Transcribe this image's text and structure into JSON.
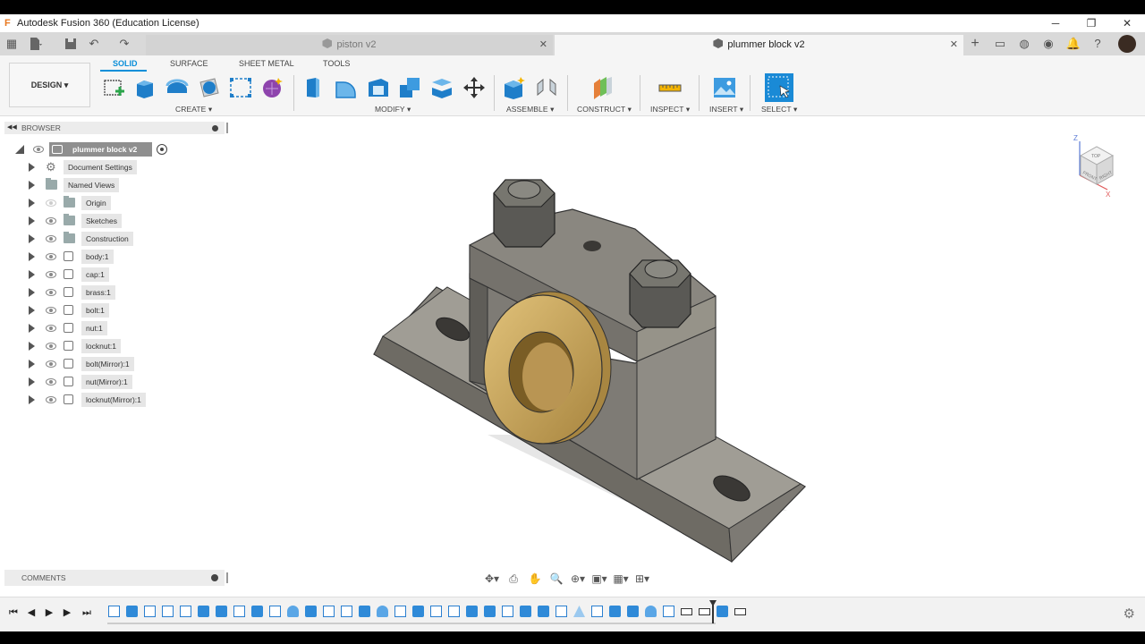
{
  "window": {
    "title": "Autodesk Fusion 360 (Education License)",
    "controls": [
      "─",
      "❐",
      "✕"
    ]
  },
  "tabs": [
    {
      "title": "piston v2",
      "active": false
    },
    {
      "title": "plummer block v2",
      "active": true
    }
  ],
  "toolbar": {
    "workspace": "DESIGN ▾",
    "workspace_tabs": [
      "SOLID",
      "SURFACE",
      "SHEET METAL",
      "TOOLS"
    ],
    "groups": {
      "create": "CREATE ▾",
      "modify": "MODIFY ▾",
      "assemble": "ASSEMBLE ▾",
      "construct": "CONSTRUCT ▾",
      "inspect": "INSPECT ▾",
      "insert": "INSERT ▾",
      "select": "SELECT ▾"
    }
  },
  "browser": {
    "title": "BROWSER",
    "root": "plummer block v2",
    "items": [
      {
        "label": "Document Settings",
        "icon": "gear-icon"
      },
      {
        "label": "Named Views",
        "icon": "folder-icon"
      },
      {
        "label": "Origin",
        "icon": "folder-icon",
        "visible": false
      },
      {
        "label": "Sketches",
        "icon": "folder-icon"
      },
      {
        "label": "Construction",
        "icon": "folder-icon"
      },
      {
        "label": "body:1",
        "icon": "component-icon"
      },
      {
        "label": "cap:1",
        "icon": "component-icon"
      },
      {
        "label": "brass:1",
        "icon": "component-icon"
      },
      {
        "label": "bolt:1",
        "icon": "component-icon"
      },
      {
        "label": "nut:1",
        "icon": "component-icon"
      },
      {
        "label": "locknut:1",
        "icon": "component-icon"
      },
      {
        "label": "bolt(Mirror):1",
        "icon": "component-icon"
      },
      {
        "label": "nut(Mirror):1",
        "icon": "component-icon"
      },
      {
        "label": "locknut(Mirror):1",
        "icon": "component-icon"
      }
    ]
  },
  "comments": {
    "title": "COMMENTS"
  },
  "viewcube": {
    "faces": [
      "TOP",
      "FRONT",
      "RIGHT"
    ],
    "axes": [
      "Z",
      "X"
    ]
  },
  "colors": {
    "accent": "#0a8fd9",
    "model_gray": "#7d7a74",
    "brass": "#c9a35a",
    "select_blue": "#1a8ad6"
  }
}
